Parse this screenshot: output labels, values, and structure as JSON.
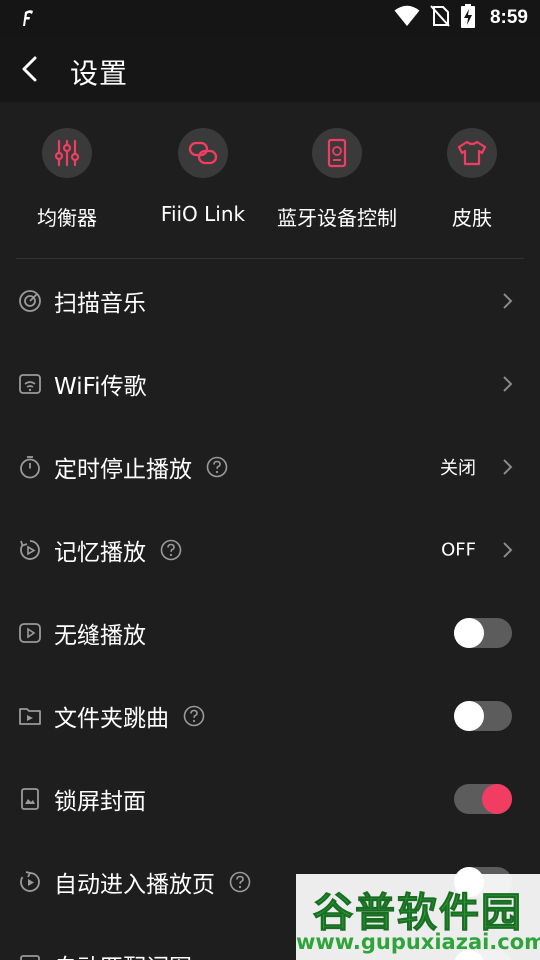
{
  "status_bar": {
    "time": "8:59",
    "icons": [
      "app-notification-icon",
      "wifi-icon",
      "no-sim-icon",
      "battery-charging-icon"
    ]
  },
  "header": {
    "back_icon": "back-arrow-icon",
    "title": "设置"
  },
  "quick_actions": [
    {
      "label": "均衡器",
      "icon": "equalizer-icon",
      "color": "#f23d63"
    },
    {
      "label": "FiiO Link",
      "icon": "link-icon",
      "color": "#f23d63"
    },
    {
      "label": "蓝牙设备控制",
      "icon": "bluetooth-device-icon",
      "color": "#f23d63"
    },
    {
      "label": "皮肤",
      "icon": "tshirt-icon",
      "color": "#f23d63"
    }
  ],
  "settings": {
    "scan": {
      "label": "扫描音乐",
      "icon": "scan-icon"
    },
    "wifi": {
      "label": "WiFi传歌",
      "icon": "wifi-transfer-icon"
    },
    "timer": {
      "label": "定时停止播放",
      "icon": "timer-icon",
      "value": "关闭"
    },
    "memory": {
      "label": "记忆播放",
      "icon": "memory-play-icon",
      "value": "OFF"
    },
    "gapless": {
      "label": "无缝播放",
      "icon": "gapless-icon",
      "enabled": false
    },
    "folder_skip": {
      "label": "文件夹跳曲",
      "icon": "folder-skip-icon",
      "enabled": false
    },
    "lock_cover": {
      "label": "锁屏封面",
      "icon": "lock-screen-icon",
      "enabled": true
    },
    "auto_enter": {
      "label": "自动进入播放页",
      "icon": "auto-play-page-icon",
      "enabled": false
    },
    "auto_lyrics": {
      "label": "自动匹配词图",
      "icon": "lyrics-icon",
      "enabled": false
    }
  },
  "colors": {
    "accent": "#f23d63",
    "background": "#1e1e1e",
    "header": "#161616",
    "icon_gray": "#9a9a9a"
  },
  "watermark": {
    "title": "谷普软件园",
    "url": "www.gupuxiazai.com"
  }
}
